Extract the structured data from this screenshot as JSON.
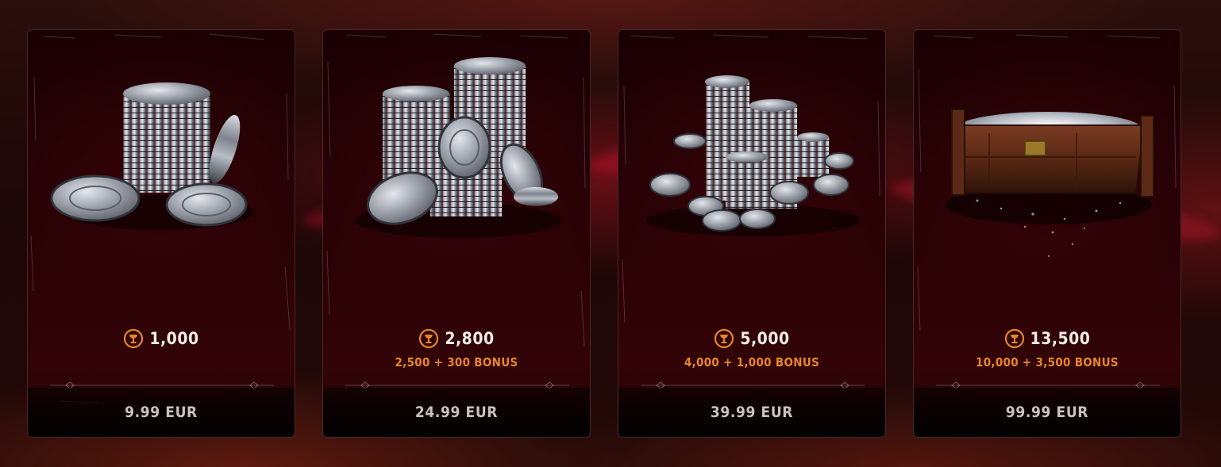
{
  "accent_color": "#e8862a",
  "currency_icon": "chalice-coin-icon",
  "packs": [
    {
      "amount": "1,000",
      "bonus": "",
      "price": "9.99 EUR",
      "art": "small-coin-stack"
    },
    {
      "amount": "2,800",
      "bonus": "2,500 + 300 BONUS",
      "price": "24.99 EUR",
      "art": "medium-coin-stacks"
    },
    {
      "amount": "5,000",
      "bonus": "4,000 + 1,000 BONUS",
      "price": "39.99 EUR",
      "art": "large-coin-stacks"
    },
    {
      "amount": "13,500",
      "bonus": "10,000 + 3,500 BONUS",
      "price": "99.99 EUR",
      "art": "coin-chest"
    }
  ]
}
